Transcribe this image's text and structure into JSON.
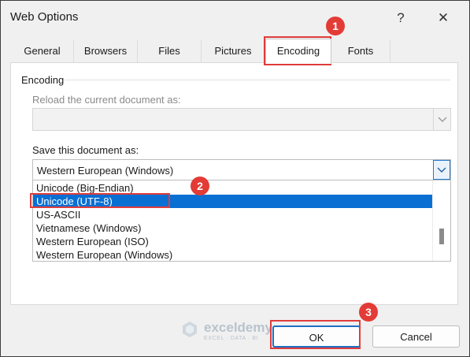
{
  "window": {
    "title": "Web Options",
    "help_glyph": "?",
    "close_glyph": "✕"
  },
  "tabs": [
    {
      "label": "General"
    },
    {
      "label": "Browsers"
    },
    {
      "label": "Files"
    },
    {
      "label": "Pictures"
    },
    {
      "label": "Encoding",
      "active": true
    },
    {
      "label": "Fonts"
    }
  ],
  "encoding": {
    "section_label": "Encoding",
    "reload_label": "Reload the current document as:",
    "reload_value": "",
    "save_label": "Save this document as:",
    "save_value": "Western European (Windows)",
    "options": [
      "Unicode (Big-Endian)",
      "Unicode (UTF-8)",
      "US-ASCII",
      "Vietnamese (Windows)",
      "Western European (ISO)",
      "Western European (Windows)"
    ],
    "selected_option": "Unicode (UTF-8)"
  },
  "buttons": {
    "ok": "OK",
    "cancel": "Cancel"
  },
  "annotations": {
    "step1": "1",
    "step2": "2",
    "step3": "3",
    "color": "#e33b36"
  },
  "watermark": {
    "name": "exceldemy",
    "tagline": "EXCEL · DATA · BI"
  },
  "colors": {
    "selection": "#0a6fd3",
    "focus_border": "#1f6fc5",
    "highlight": "#e03c3c"
  }
}
